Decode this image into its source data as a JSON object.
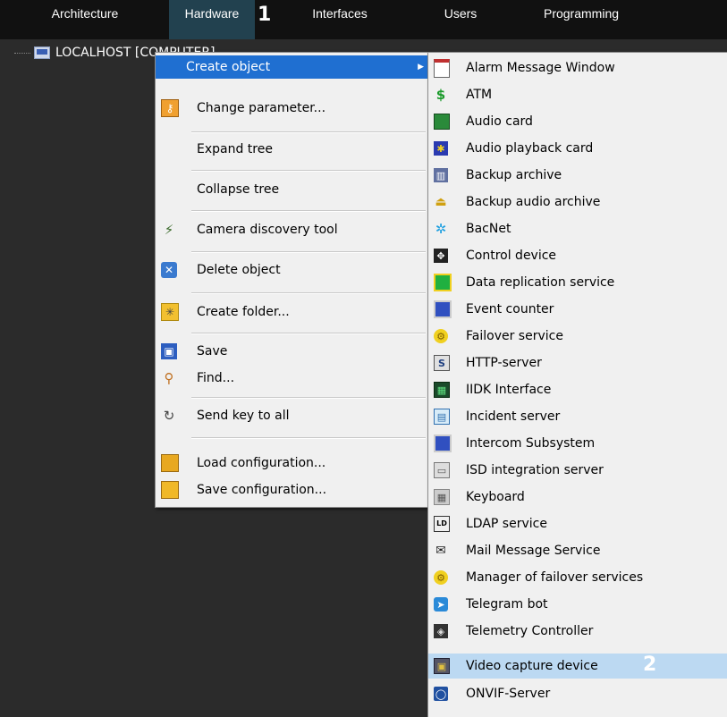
{
  "tabs": [
    "Architecture",
    "Hardware",
    "Interfaces",
    "Users",
    "Programming"
  ],
  "markers": [
    "1",
    "2"
  ],
  "tree": {
    "node_label": "LOCALHOST [COMPUTER]"
  },
  "context_menu": {
    "items": [
      {
        "label": "Create object",
        "icon": "create-object-icon"
      },
      {
        "label": "Change parameter...",
        "icon": "key-icon"
      },
      {
        "label": "Expand tree",
        "icon": ""
      },
      {
        "label": "Collapse tree",
        "icon": ""
      },
      {
        "label": "Camera discovery tool",
        "icon": "magic-wand-icon"
      },
      {
        "label": "Delete object",
        "icon": "delete-icon"
      },
      {
        "label": "Create folder...",
        "icon": "new-folder-icon"
      },
      {
        "label": "Save",
        "icon": "save-icon"
      },
      {
        "label": "Find...",
        "icon": "magnifier-icon"
      },
      {
        "label": "Send key to all",
        "icon": "refresh-icon"
      },
      {
        "label": "Load configuration...",
        "icon": "folder-open-icon"
      },
      {
        "label": "Save configuration...",
        "icon": "folder-icon"
      }
    ]
  },
  "submenu": {
    "items": [
      {
        "label": "Alarm Message Window",
        "icon": "alarm-window-icon"
      },
      {
        "label": "ATM",
        "icon": "dollar-icon"
      },
      {
        "label": "Audio card",
        "icon": "audio-card-icon"
      },
      {
        "label": "Audio playback card",
        "icon": "playback-card-icon"
      },
      {
        "label": "Backup archive",
        "icon": "backup-archive-icon"
      },
      {
        "label": "Backup audio archive",
        "icon": "backup-audio-icon"
      },
      {
        "label": "BacNet",
        "icon": "bacnet-icon"
      },
      {
        "label": "Control device",
        "icon": "control-device-icon"
      },
      {
        "label": "Data replication service",
        "icon": "replication-icon"
      },
      {
        "label": "Event counter",
        "icon": "monitor-icon"
      },
      {
        "label": "Failover service",
        "icon": "failover-icon"
      },
      {
        "label": "HTTP-server",
        "icon": "http-server-icon"
      },
      {
        "label": "IIDK Interface",
        "icon": "iidk-icon"
      },
      {
        "label": "Incident server",
        "icon": "incident-server-icon"
      },
      {
        "label": "Intercom Subsystem",
        "icon": "intercom-icon"
      },
      {
        "label": "ISD integration server",
        "icon": "isd-icon"
      },
      {
        "label": "Keyboard",
        "icon": "keyboard-icon"
      },
      {
        "label": "LDAP service",
        "icon": "ldap-icon"
      },
      {
        "label": "Mail Message Service",
        "icon": "mail-icon"
      },
      {
        "label": "Manager of failover services",
        "icon": "failover-manager-icon"
      },
      {
        "label": "Telegram bot",
        "icon": "telegram-icon"
      },
      {
        "label": "Telemetry Controller",
        "icon": "telemetry-icon"
      },
      {
        "label": "Video capture device",
        "icon": "chip-icon"
      },
      {
        "label": "ONVIF-Server",
        "icon": "onvif-icon"
      }
    ]
  }
}
